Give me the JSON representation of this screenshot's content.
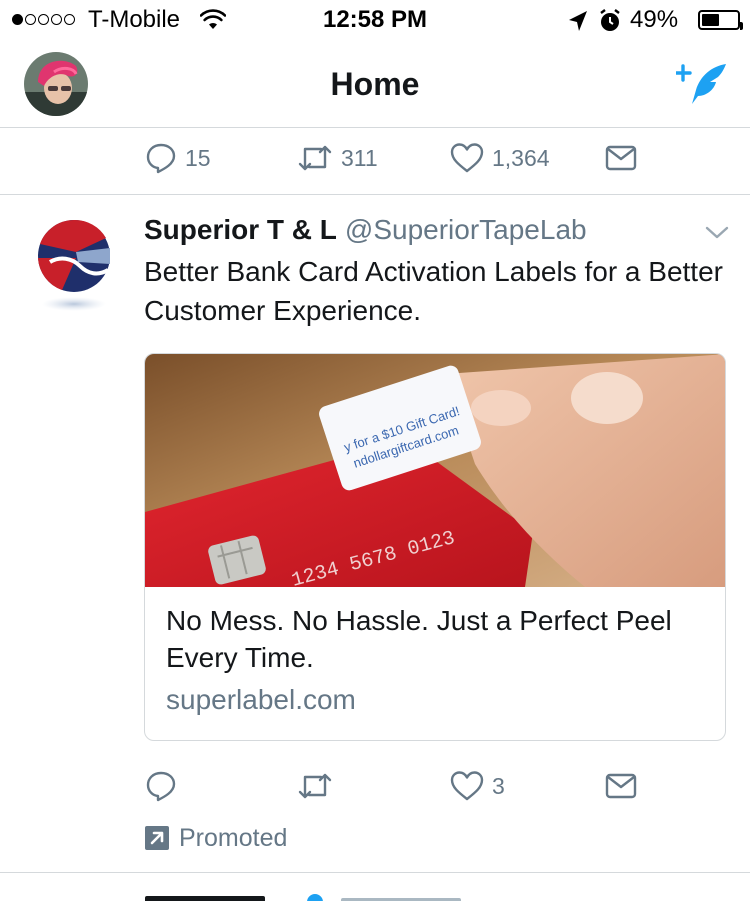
{
  "status_bar": {
    "carrier": "T-Mobile",
    "time": "12:58 PM",
    "battery_percent": "49%",
    "battery_level": 0.49,
    "signal_bars": 1
  },
  "nav": {
    "title": "Home",
    "accent_color": "#1da1f2"
  },
  "previous_tweet_actions": {
    "replies": "15",
    "retweets": "311",
    "likes": "1,364"
  },
  "tweet": {
    "author": "Superior T & L",
    "handle": "@SuperiorTapeLab",
    "text": "Better Bank Card Activation Labels for a Better Customer Experience.",
    "card": {
      "image_label_text": "y for a $10 Gift Card! ndollargiftcard.com",
      "image_card_number": "1234 5678 0123",
      "title": "No Mess. No Hassle. Just a Perfect Peel Every Time.",
      "domain": "superlabel.com"
    },
    "actions": {
      "replies": "",
      "retweets": "",
      "likes": "3"
    },
    "promoted_label": "Promoted"
  },
  "icons": [
    "wifi-icon",
    "location-arrow-icon",
    "alarm-icon",
    "battery-icon",
    "compose-tweet-icon",
    "reply-icon",
    "retweet-icon",
    "like-icon",
    "direct-message-icon",
    "chevron-down-icon",
    "promoted-icon"
  ],
  "colors": {
    "text_primary": "#14171a",
    "text_secondary": "#657786",
    "divider": "#d5d9dc",
    "brand_blue": "#1da1f2",
    "card_red": "#d0202a"
  }
}
